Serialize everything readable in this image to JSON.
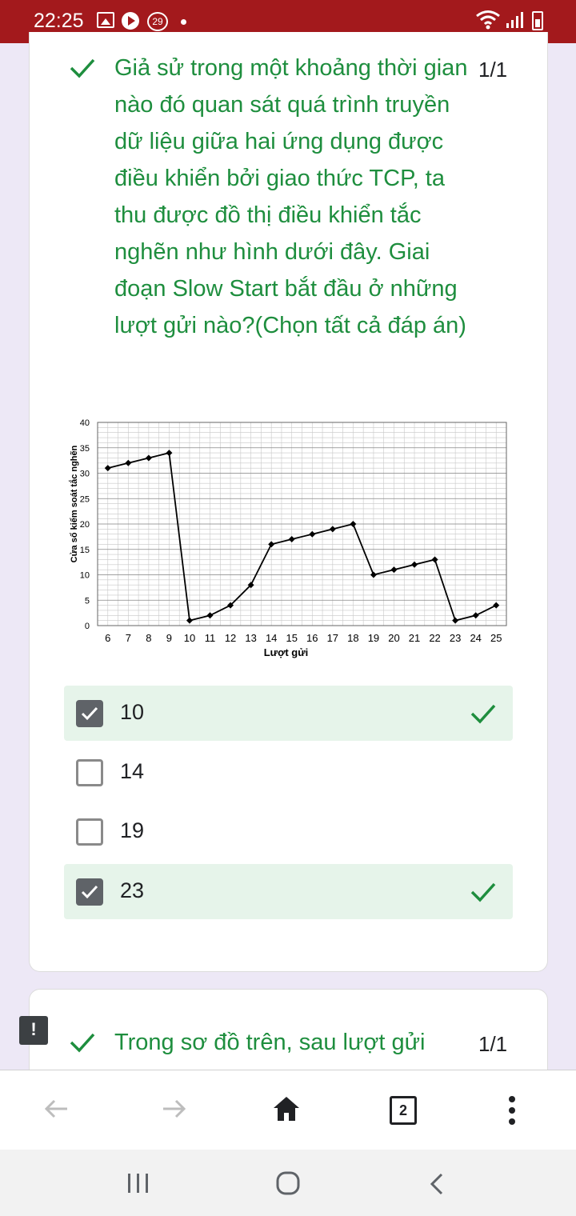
{
  "status_bar": {
    "time": "22:25",
    "notification_count": "29",
    "icons": [
      "image-icon",
      "play-icon",
      "notification-badge-icon",
      "dot-icon",
      "wifi-icon",
      "signal-icon",
      "battery-charging-icon"
    ]
  },
  "question1": {
    "text": "Giả sử trong một khoảng thời gian nào đó quan sát quá trình truyền dữ liệu giữa hai ứng dụng được điều khiển bởi giao thức TCP, ta thu được đồ thị điều khiển tắc nghẽn như hình dưới đây. Giai đoạn Slow Start bắt đầu ở những lượt gửi nào?(Chọn tất cả đáp án)",
    "score": "1/1",
    "options": [
      {
        "label": "10",
        "checked": true,
        "correct": true
      },
      {
        "label": "14",
        "checked": false,
        "correct": false
      },
      {
        "label": "19",
        "checked": false,
        "correct": false
      },
      {
        "label": "23",
        "checked": true,
        "correct": true
      }
    ]
  },
  "question2": {
    "text": "Trong sơ đồ trên, sau lượt gửi",
    "score": "1/1"
  },
  "browser": {
    "tab_count": "2"
  },
  "colors": {
    "status_bar": "#a3191c",
    "correct_green": "#1e8e3e",
    "correct_bg": "#e6f4ea"
  },
  "chart_data": {
    "type": "line",
    "xlabel": "Lượt gửi",
    "ylabel": "Cửa sổ kiểm soát tắc nghẽn",
    "x": [
      6,
      7,
      8,
      9,
      10,
      11,
      12,
      13,
      14,
      15,
      16,
      17,
      18,
      19,
      20,
      21,
      22,
      23,
      24,
      25
    ],
    "values": [
      31,
      32,
      33,
      34,
      1,
      2,
      4,
      8,
      16,
      17,
      18,
      19,
      20,
      10,
      11,
      12,
      13,
      1,
      2,
      4
    ],
    "xlim": [
      5.5,
      25.5
    ],
    "ylim": [
      0,
      40
    ],
    "yticks": [
      0,
      5,
      10,
      15,
      20,
      25,
      30,
      35,
      40
    ],
    "grid": true
  }
}
